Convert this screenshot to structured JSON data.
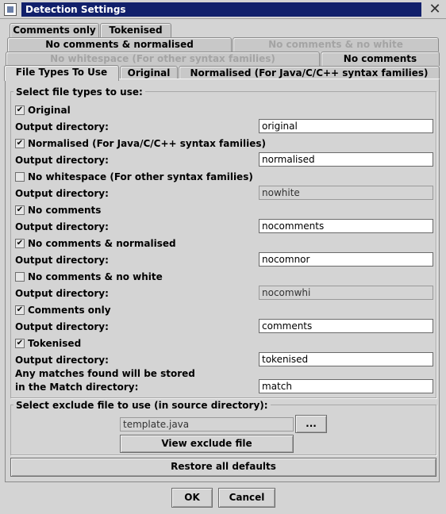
{
  "window": {
    "title": "Detection Settings",
    "close_glyph": "✕"
  },
  "tabs": {
    "row1": [
      {
        "label": "Comments only",
        "disabled": false
      },
      {
        "label": "Tokenised",
        "disabled": false
      }
    ],
    "row2": [
      {
        "label": "No comments & normalised",
        "disabled": false
      },
      {
        "label": "No comments & no white",
        "disabled": true
      }
    ],
    "row3": [
      {
        "label": "No whitespace (For other syntax families)",
        "disabled": true
      },
      {
        "label": "No comments",
        "disabled": false
      }
    ],
    "row4": [
      {
        "label": "File Types To Use",
        "active": true
      },
      {
        "label": "Original",
        "disabled": false
      },
      {
        "label": "Normalised (For Java/C/C++ syntax families)",
        "disabled": false
      }
    ]
  },
  "file_types": {
    "legend": "Select file types to use:",
    "output_label": "Output directory:",
    "items": [
      {
        "label": "Original",
        "checked": true,
        "output": "original",
        "enabled": true
      },
      {
        "label": "Normalised (For Java/C/C++ syntax families)",
        "checked": true,
        "output": "normalised",
        "enabled": true
      },
      {
        "label": "No whitespace (For other syntax families)",
        "checked": false,
        "output": "nowhite",
        "enabled": false
      },
      {
        "label": "No comments",
        "checked": true,
        "output": "nocomments",
        "enabled": true
      },
      {
        "label": "No comments & normalised",
        "checked": true,
        "output": "nocomnor",
        "enabled": true
      },
      {
        "label": "No comments & no white",
        "checked": false,
        "output": "nocomwhi",
        "enabled": false
      },
      {
        "label": "Comments only",
        "checked": true,
        "output": "comments",
        "enabled": true
      },
      {
        "label": "Tokenised",
        "checked": true,
        "output": "tokenised",
        "enabled": true
      }
    ],
    "match_label_line1": "Any matches found will be stored",
    "match_label_line2": "in the Match directory:",
    "match_value": "match",
    "check_glyph": "✔"
  },
  "exclude": {
    "legend": "Select exclude file to use (in source directory):",
    "file_value": "template.java",
    "browse_label": "...",
    "view_label": "View exclude file"
  },
  "restore_label": "Restore all defaults",
  "ok_label": "OK",
  "cancel_label": "Cancel"
}
